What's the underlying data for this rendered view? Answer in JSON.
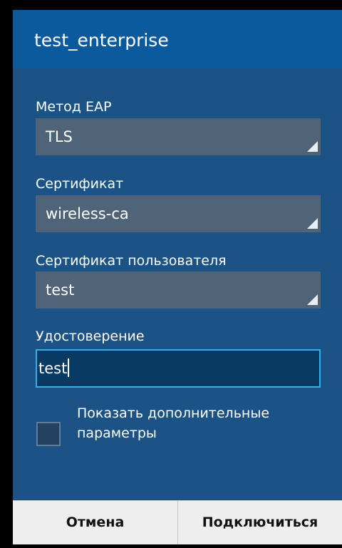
{
  "dialog": {
    "title": "test_enterprise"
  },
  "fields": {
    "eap_method": {
      "label": "Метод EAP",
      "value": "TLS"
    },
    "ca_certificate": {
      "label": "Сертификат",
      "value": "wireless-ca"
    },
    "user_certificate": {
      "label": "Сертификат пользователя",
      "value": "test"
    },
    "identity": {
      "label": "Удостоверение",
      "value": "test"
    }
  },
  "advanced": {
    "checked": false,
    "label": "Показать дополнительные параметры"
  },
  "buttons": {
    "cancel": "Отмена",
    "connect": "Подключиться"
  },
  "colors": {
    "dialog_background": "#1b5387",
    "title_bar": "#0c5a9e",
    "spinner": "#4f6479",
    "input_focus_border": "#38aee8",
    "button_bar": "#eeeeee"
  }
}
